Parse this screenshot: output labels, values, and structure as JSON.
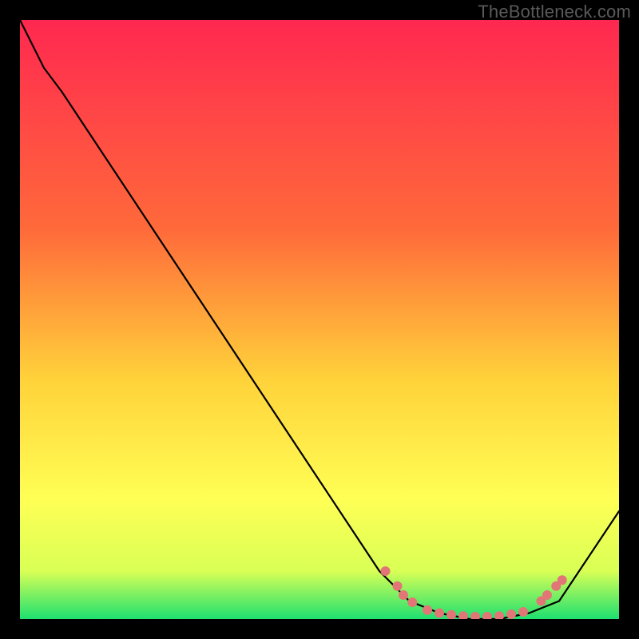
{
  "watermark": "TheBottleneck.com",
  "colors": {
    "black": "#000000",
    "curve": "#000000",
    "dot": "#e27676",
    "grad_top": "#ff2850",
    "grad_mid1": "#ff6a3a",
    "grad_mid2": "#ffd23a",
    "grad_mid3": "#ffff55",
    "grad_mid4": "#d9ff55",
    "grad_bot": "#1ee070"
  },
  "chart_data": {
    "type": "line",
    "title": "",
    "xlabel": "",
    "ylabel": "",
    "xlim": [
      0,
      100
    ],
    "ylim": [
      0,
      100
    ],
    "series": [
      {
        "name": "curve",
        "x": [
          0,
          4,
          7,
          60,
          65,
          70,
          75,
          80,
          85,
          90,
          100
        ],
        "y": [
          100,
          92,
          88,
          8,
          3,
          1,
          0,
          0,
          1,
          3,
          18
        ]
      }
    ],
    "dots": [
      {
        "x": 61,
        "y": 8
      },
      {
        "x": 63,
        "y": 5.5
      },
      {
        "x": 64,
        "y": 4
      },
      {
        "x": 65.5,
        "y": 2.8
      },
      {
        "x": 68,
        "y": 1.5
      },
      {
        "x": 70,
        "y": 1
      },
      {
        "x": 72,
        "y": 0.7
      },
      {
        "x": 74,
        "y": 0.5
      },
      {
        "x": 76,
        "y": 0.4
      },
      {
        "x": 78,
        "y": 0.4
      },
      {
        "x": 80,
        "y": 0.5
      },
      {
        "x": 82,
        "y": 0.8
      },
      {
        "x": 84,
        "y": 1.2
      },
      {
        "x": 87,
        "y": 3
      },
      {
        "x": 88,
        "y": 4
      },
      {
        "x": 89.5,
        "y": 5.5
      },
      {
        "x": 90.5,
        "y": 6.5
      }
    ],
    "gradient_stops": [
      {
        "offset": 0.0,
        "key": "grad_top"
      },
      {
        "offset": 0.35,
        "key": "grad_mid1"
      },
      {
        "offset": 0.6,
        "key": "grad_mid2"
      },
      {
        "offset": 0.8,
        "key": "grad_mid3"
      },
      {
        "offset": 0.92,
        "key": "grad_mid4"
      },
      {
        "offset": 1.0,
        "key": "grad_bot"
      }
    ]
  }
}
